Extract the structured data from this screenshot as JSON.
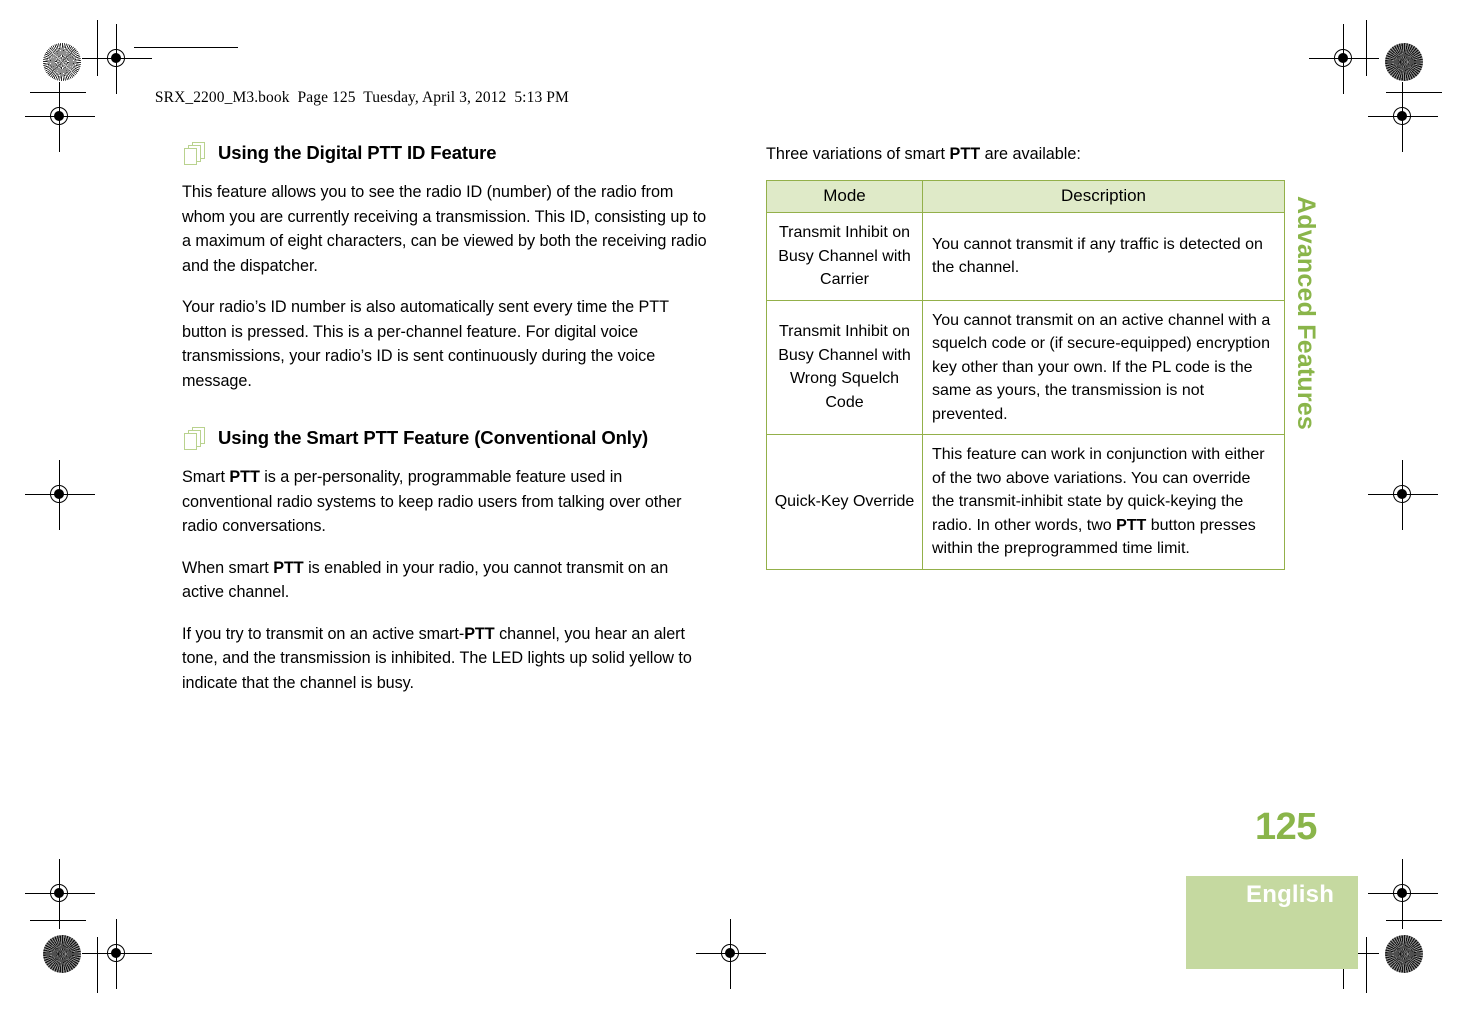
{
  "document": {
    "header_line": "SRX_2200_M3.book  Page 125  Tuesday, April 3, 2012  5:13 PM",
    "chapter_title": "Advanced Features",
    "page_number": "125",
    "language": "English"
  },
  "colors": {
    "accent_green": "#8ab54a",
    "tab_green": "#c5d9a0",
    "table_header_green": "#dfeac8",
    "table_border_green": "#93b04a"
  },
  "left_column": {
    "heading_1": "Using the Digital PTT ID Feature",
    "paragraph_1": "This feature allows you to see the radio ID (number) of the radio from whom you are currently receiving a transmission. This ID, consisting up to a maximum of eight characters, can be viewed by both the receiving radio and the dispatcher.",
    "paragraph_2": "Your radio’s ID number is also automatically sent every time the PTT button is pressed. This is a per-channel feature. For digital voice transmissions, your radio’s ID is sent continuously during the voice message.",
    "heading_2": "Using the Smart PTT Feature (Conventional Only)",
    "paragraph_3_pre": "Smart ",
    "paragraph_3_bold": "PTT",
    "paragraph_3_post": " is a per-personality, programmable feature used in conventional radio systems to keep radio users from talking over other radio conversations.",
    "paragraph_4_pre": "When smart ",
    "paragraph_4_bold": "PTT",
    "paragraph_4_post": " is enabled in your radio, you cannot transmit on an active channel.",
    "paragraph_5_pre": "If you try to transmit on an active smart-",
    "paragraph_5_bold": "PTT",
    "paragraph_5_post": " channel, you hear an alert tone, and the transmission is inhibited. The LED lights up solid yellow to indicate that the channel is busy."
  },
  "right_column": {
    "lead_pre": "Three variations of smart ",
    "lead_bold": "PTT",
    "lead_post": " are available:",
    "table": {
      "headers": [
        "Mode",
        "Description"
      ],
      "rows": [
        {
          "mode": "Transmit Inhibit on Busy Channel with Carrier",
          "description": "You cannot transmit if any traffic is detected on the channel."
        },
        {
          "mode": "Transmit Inhibit on Busy Channel with Wrong Squelch Code",
          "description": "You cannot transmit on an active channel with a squelch code or (if secure-equipped) encryption key other than your own. If the PL code is the same as yours, the transmission is not prevented."
        },
        {
          "mode": "Quick-Key Override",
          "description_pre": "This feature can work in conjunction with either of the two above variations. You can override the transmit-inhibit state by quick-keying the radio. In other words, two ",
          "description_bold": "PTT",
          "description_post": " button presses within the preprogrammed time limit."
        }
      ]
    }
  }
}
